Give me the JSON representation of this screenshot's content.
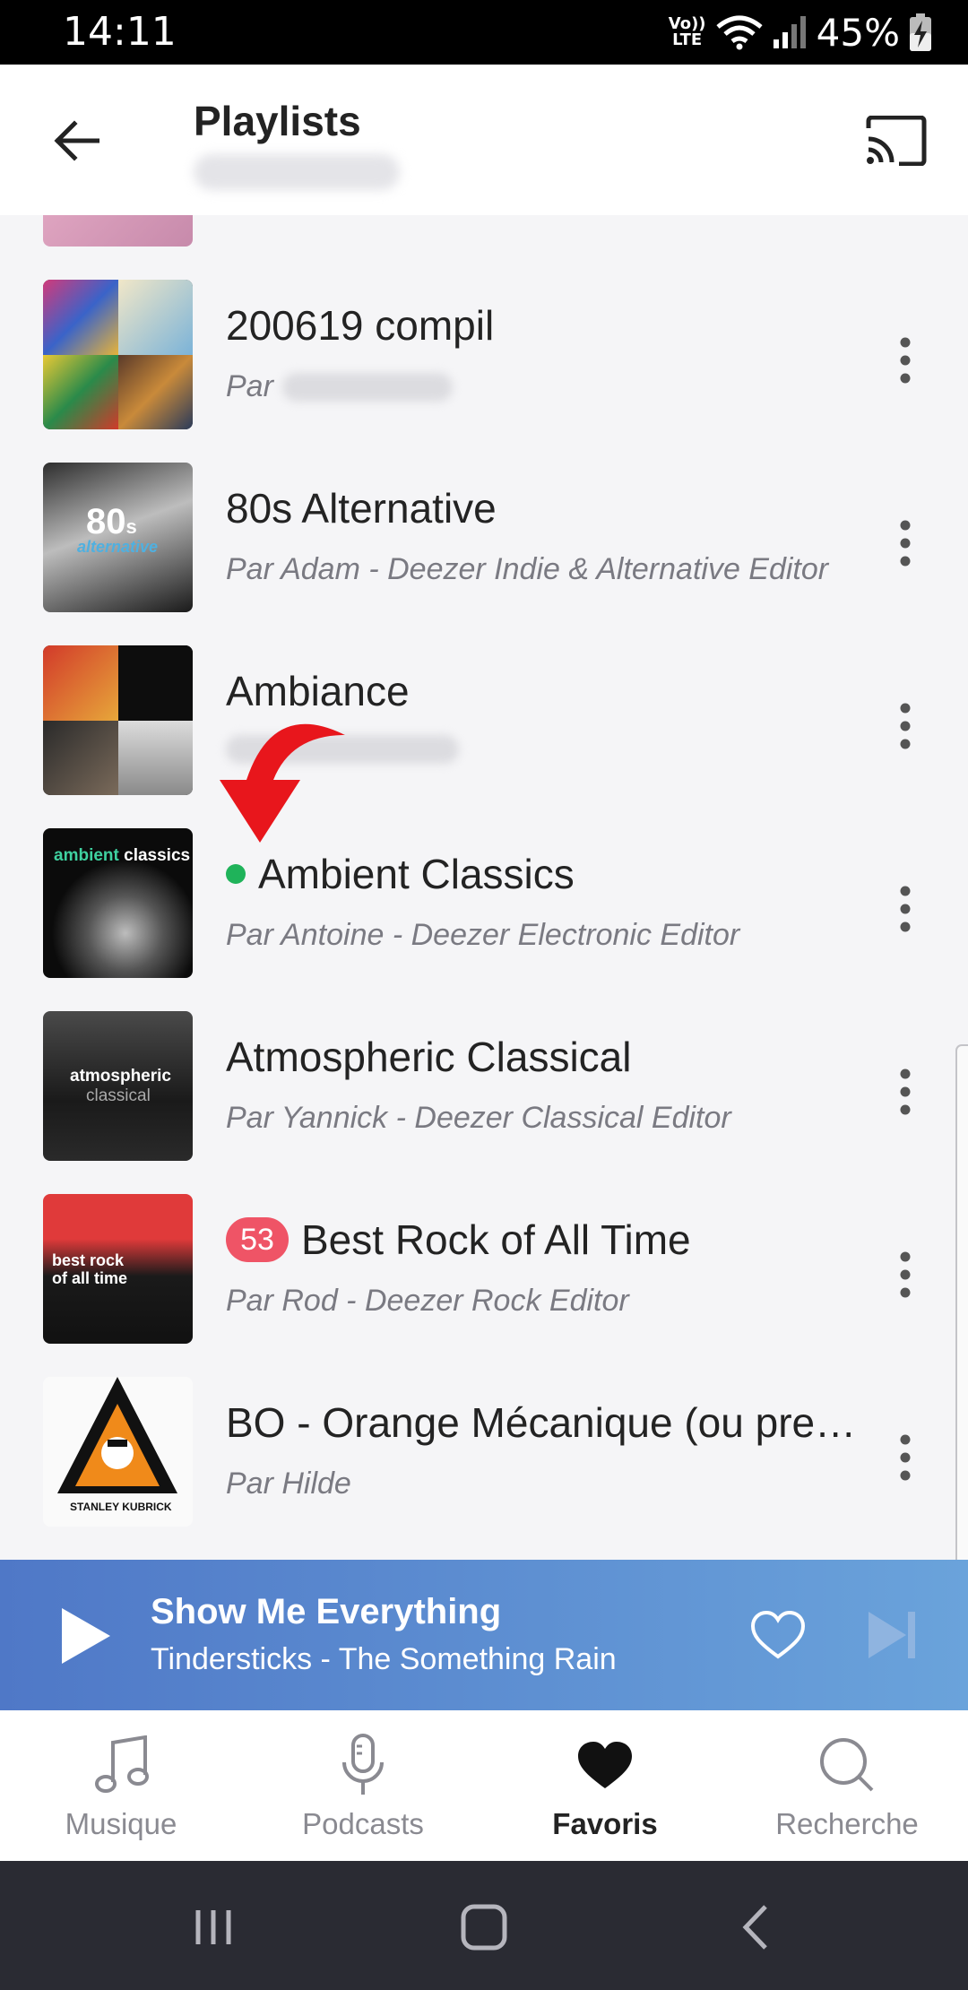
{
  "status_bar": {
    "time": "14:11",
    "volte_label": "Vo)) LTE",
    "battery_percent": "45%"
  },
  "header": {
    "title": "Playlists"
  },
  "playlists": [
    {
      "title": "200619 compil",
      "subtitle_prefix": "Par",
      "subtitle": ""
    },
    {
      "title": "80s Alternative",
      "subtitle_prefix": "",
      "subtitle": "Par Adam - Deezer Indie & Alternative Editor"
    },
    {
      "title": "Ambiance",
      "subtitle_prefix": "",
      "subtitle": ""
    },
    {
      "title": "Ambient Classics",
      "subtitle_prefix": "",
      "subtitle": "Par Antoine - Deezer Electronic Editor"
    },
    {
      "title": "Atmospheric Classical",
      "subtitle_prefix": "",
      "subtitle": "Par Yannick - Deezer Classical Editor"
    },
    {
      "title": "Best Rock of All Time",
      "subtitle_prefix": "",
      "subtitle": "Par Rod - Deezer Rock Editor",
      "badge": "53"
    },
    {
      "title": "BO - Orange Mécanique (ou pre…",
      "subtitle_prefix": "",
      "subtitle": "Par Hilde"
    }
  ],
  "covers": {
    "c80s_big": "80",
    "c80s_s": "s",
    "c80s_alt": "alternative",
    "ambient_word1": "ambient",
    "ambient_word2": "classics",
    "atmo_word1": "atmospheric",
    "atmo_word2": "classical",
    "rock_line1": "best rock",
    "rock_line2": "of all time",
    "bo_credit": "STANLEY KUBRICK"
  },
  "player": {
    "track": "Show Me Everything",
    "artist_album": "Tindersticks - The Something Rain"
  },
  "bottom_nav": [
    {
      "label": "Musique",
      "icon": "music-note-icon",
      "active": false
    },
    {
      "label": "Podcasts",
      "icon": "microphone-icon",
      "active": false
    },
    {
      "label": "Favoris",
      "icon": "heart-icon",
      "active": true
    },
    {
      "label": "Recherche",
      "icon": "search-icon",
      "active": false
    }
  ],
  "colors": {
    "accent_green": "#1fb35a",
    "badge_red": "#ef5466",
    "player_start": "#4f78c7",
    "player_end": "#6aa3db",
    "annotation_red": "#e8161c"
  }
}
